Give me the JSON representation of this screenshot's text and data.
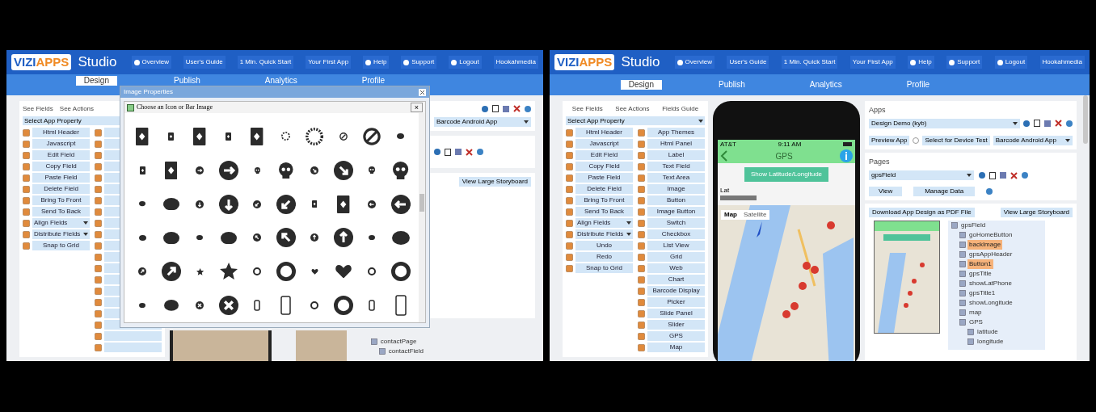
{
  "left_screen": {
    "header": {
      "logo_prefix": "VIZI",
      "logo_suffix": "APPS",
      "product": "Studio",
      "nav": [
        {
          "label": "Overview",
          "has_icon": true
        },
        {
          "label": "User's Guide",
          "has_icon": false
        },
        {
          "label": "1 Min. Quick Start",
          "has_icon": false
        },
        {
          "label": "Your First App",
          "has_icon": false
        },
        {
          "label": "Help",
          "has_icon": true
        },
        {
          "label": "Support",
          "has_icon": true
        },
        {
          "label": "Logout",
          "has_icon": true
        },
        {
          "label": "Hookahmedia",
          "has_icon": false
        }
      ],
      "tabs": [
        {
          "label": "Design",
          "selected": true
        },
        {
          "label": "Publish",
          "selected": false
        },
        {
          "label": "Analytics",
          "selected": false
        },
        {
          "label": "Profile",
          "selected": false
        }
      ]
    },
    "field_tabs": [
      "See Fields",
      "See Actions"
    ],
    "property_select": "Select App Property",
    "tools": [
      {
        "label": "Html Header",
        "kind": "button"
      },
      {
        "label": "Javascript",
        "kind": "button"
      },
      {
        "label": "Edit Field",
        "kind": "button"
      },
      {
        "label": "Copy Field",
        "kind": "button"
      },
      {
        "label": "Paste Field",
        "kind": "button"
      },
      {
        "label": "Delete Field",
        "kind": "button"
      },
      {
        "label": "Bring To Front",
        "kind": "button"
      },
      {
        "label": "Send To Back",
        "kind": "button"
      },
      {
        "label": "Align Fields",
        "kind": "dropdown"
      },
      {
        "label": "Distribute Fields",
        "kind": "dropdown"
      },
      {
        "label": "Snap to Grid",
        "kind": "button"
      }
    ],
    "dialog": {
      "title": "Image Properties",
      "panel_title": "Choose an Icon or Bar Image",
      "close": "×"
    },
    "target_select": "Barcode Android App",
    "storyboard_button": "View Large Storyboard",
    "tree": [
      {
        "label": "contactPage",
        "selected": false,
        "children": [
          {
            "label": "contactField",
            "selected": false
          }
        ]
      }
    ]
  },
  "right_screen": {
    "header": {
      "logo_prefix": "VIZI",
      "logo_suffix": "APPS",
      "product": "Studio",
      "nav": [
        {
          "label": "Overview",
          "has_icon": true
        },
        {
          "label": "User's Guide",
          "has_icon": false
        },
        {
          "label": "1 Min. Quick Start",
          "has_icon": false
        },
        {
          "label": "Your First App",
          "has_icon": false
        },
        {
          "label": "Help",
          "has_icon": true
        },
        {
          "label": "Support",
          "has_icon": true
        },
        {
          "label": "Logout",
          "has_icon": true
        },
        {
          "label": "Hookahmedia",
          "has_icon": false
        }
      ],
      "tabs": [
        {
          "label": "Design",
          "selected": true
        },
        {
          "label": "Publish",
          "selected": false
        },
        {
          "label": "Analytics",
          "selected": false
        },
        {
          "label": "Profile",
          "selected": false
        }
      ]
    },
    "field_tabs": [
      "See Fields",
      "See Actions",
      "Fields Guide"
    ],
    "property_select": "Select App Property",
    "tools": [
      {
        "label": "Html Header",
        "kind": "button"
      },
      {
        "label": "Javascript",
        "kind": "button"
      },
      {
        "label": "Edit Field",
        "kind": "button"
      },
      {
        "label": "Copy Field",
        "kind": "button"
      },
      {
        "label": "Paste Field",
        "kind": "button"
      },
      {
        "label": "Delete Field",
        "kind": "button"
      },
      {
        "label": "Bring To Front",
        "kind": "button"
      },
      {
        "label": "Send To Back",
        "kind": "button"
      },
      {
        "label": "Align Fields",
        "kind": "dropdown"
      },
      {
        "label": "Distribute Fields",
        "kind": "dropdown"
      },
      {
        "label": "Undo",
        "kind": "button"
      },
      {
        "label": "Redo",
        "kind": "button"
      },
      {
        "label": "Snap to Grid",
        "kind": "button"
      }
    ],
    "fields": [
      "App Themes",
      "Html Panel",
      "Label",
      "Text Field",
      "Text Area",
      "Image",
      "Button",
      "Image Button",
      "Switch",
      "Checkbox",
      "List View",
      "Grid",
      "Web",
      "Chart",
      "Barcode Display",
      "Picker",
      "Slide Panel",
      "Slider",
      "GPS",
      "Map"
    ],
    "phone": {
      "carrier": "AT&T",
      "time": "9:11 AM",
      "title": "GPS",
      "button": "Show Latitude/Longitude",
      "lat_label": "Lat",
      "map_types": [
        {
          "label": "Map",
          "selected": true
        },
        {
          "label": "Satellite",
          "selected": false
        }
      ]
    },
    "apps": {
      "label": "Apps",
      "select": "Design Demo (kyb)",
      "preview_button": "Preview App",
      "device_test": "Select for Device Test",
      "target_select": "Barcode Android App"
    },
    "pages": {
      "label": "Pages",
      "select": "gpsField",
      "view_button": "View",
      "data_button": "Manage Data"
    },
    "storyboard": {
      "pdf_button": "Download App Design as PDF File",
      "large_button": "View Large Storyboard",
      "tree": [
        {
          "label": "gpsField",
          "selected": false,
          "children": [
            {
              "label": "goHomeButton",
              "selected": false
            },
            {
              "label": "backImage",
              "selected": true
            },
            {
              "label": "gpsAppHeader",
              "selected": false
            },
            {
              "label": "Button1",
              "selected": true
            },
            {
              "label": "gpsTitle",
              "selected": false
            },
            {
              "label": "showLatPhone",
              "selected": false
            },
            {
              "label": "gpsTitle1",
              "selected": false
            },
            {
              "label": "showLongitude",
              "selected": false
            },
            {
              "label": "map",
              "selected": false
            },
            {
              "label": "GPS",
              "selected": false,
              "children": [
                {
                  "label": "latitude",
                  "selected": false
                },
                {
                  "label": "longitude",
                  "selected": false
                }
              ]
            }
          ]
        }
      ]
    }
  }
}
